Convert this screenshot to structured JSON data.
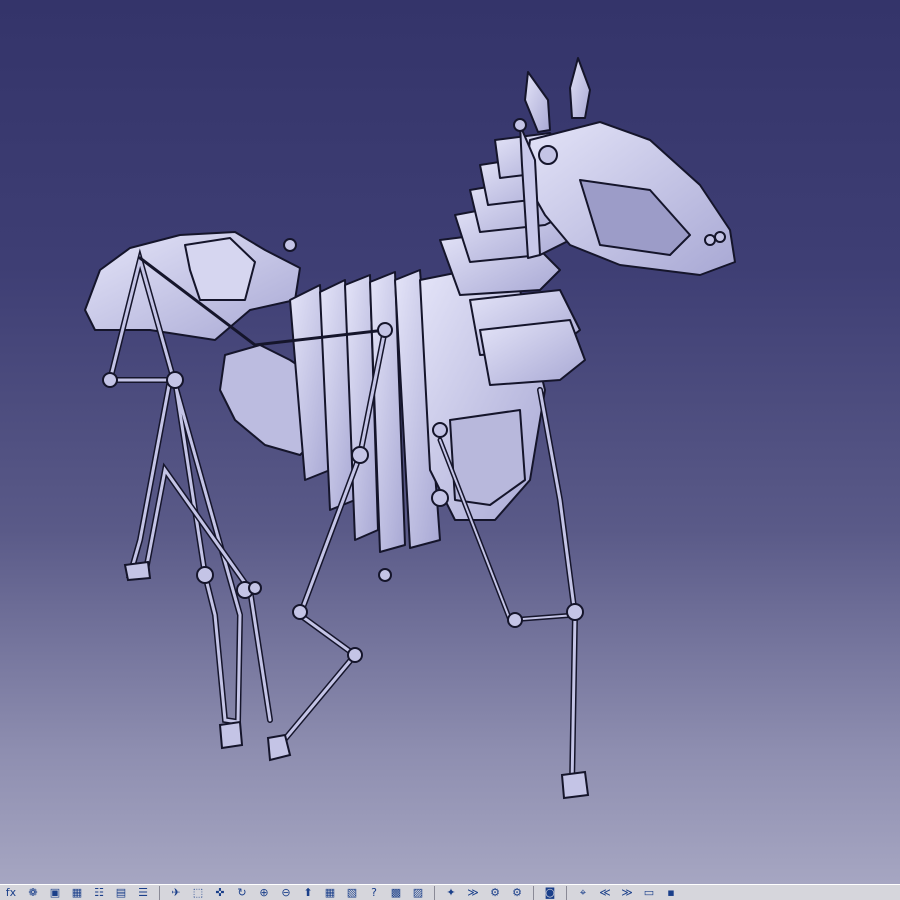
{
  "app": {
    "accent_background_top": "#34346a",
    "accent_background_bottom": "#a6a6c2",
    "model_fill": "#c4c4e6",
    "model_edge": "#15152b"
  },
  "viewport": {
    "subject": "mechanical horse assembly"
  },
  "toolbar": {
    "groups": [
      [
        {
          "name": "fx-icon",
          "glyph": "fx"
        },
        {
          "name": "globe-icon",
          "glyph": "❁"
        },
        {
          "name": "lock-icon",
          "glyph": "▣"
        },
        {
          "name": "table-icon",
          "glyph": "▦"
        },
        {
          "name": "tree-icon",
          "glyph": "☷"
        },
        {
          "name": "padlock-icon",
          "glyph": "▤"
        },
        {
          "name": "list-icon",
          "glyph": "☰"
        }
      ],
      [
        {
          "name": "fly-mode-icon",
          "glyph": "✈"
        },
        {
          "name": "fit-all-icon",
          "glyph": "⬚"
        },
        {
          "name": "pan-icon",
          "glyph": "✜"
        },
        {
          "name": "rotate-icon",
          "glyph": "↻"
        },
        {
          "name": "zoom-in-icon",
          "glyph": "⊕"
        },
        {
          "name": "zoom-out-icon",
          "glyph": "⊖"
        },
        {
          "name": "normal-view-icon",
          "glyph": "⬆"
        },
        {
          "name": "multi-view-icon",
          "glyph": "▦"
        },
        {
          "name": "iso-view-icon",
          "glyph": "▧"
        },
        {
          "name": "help-icon",
          "glyph": "?"
        },
        {
          "name": "shading-icon",
          "glyph": "▩"
        },
        {
          "name": "hide-show-icon",
          "glyph": "▨"
        }
      ],
      [
        {
          "name": "tool-a-icon",
          "glyph": "✦"
        },
        {
          "name": "tool-b-icon",
          "glyph": "≫"
        },
        {
          "name": "catalog-icon",
          "glyph": "⚙"
        },
        {
          "name": "parts-icon",
          "glyph": "⚙"
        }
      ],
      [
        {
          "name": "camera-icon",
          "glyph": "◙"
        }
      ],
      [
        {
          "name": "target-icon",
          "glyph": "⌖"
        },
        {
          "name": "first-icon",
          "glyph": "≪"
        },
        {
          "name": "last-icon",
          "glyph": "≫"
        },
        {
          "name": "comment-icon",
          "glyph": "▭"
        },
        {
          "name": "flag-icon",
          "glyph": "▪"
        }
      ]
    ]
  }
}
